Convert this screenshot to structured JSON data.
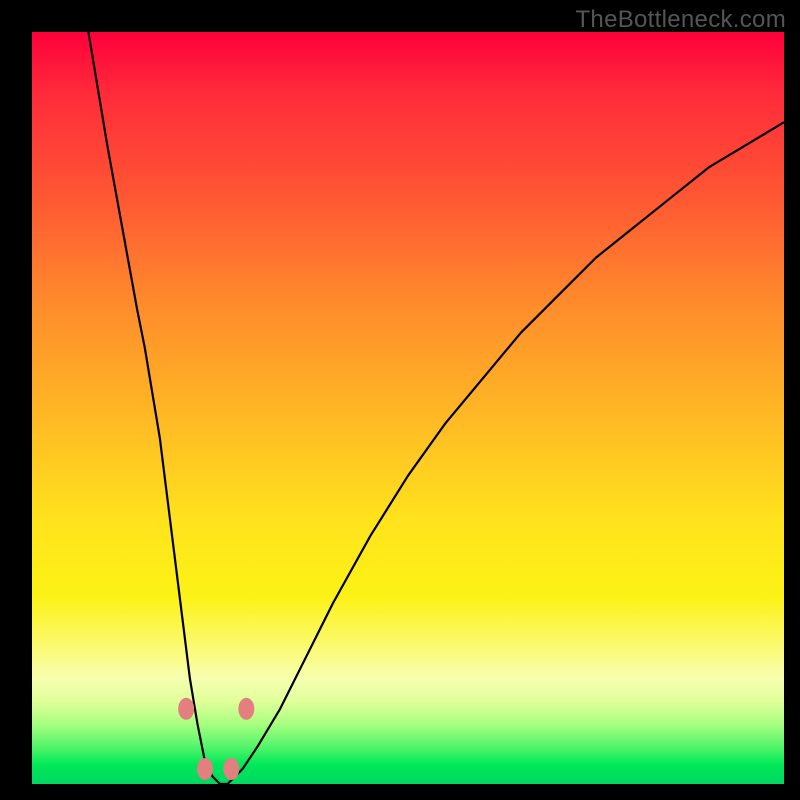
{
  "watermark": "TheBottleneck.com",
  "chart_data": {
    "type": "line",
    "title": "",
    "xlabel": "",
    "ylabel": "",
    "xlim": [
      0,
      100
    ],
    "ylim": [
      0,
      100
    ],
    "grid": false,
    "legend": false,
    "background": "rainbow-gradient-vertical",
    "series": [
      {
        "name": "curve",
        "x": [
          7.5,
          10,
          12,
          14,
          15,
          16,
          17,
          18,
          19,
          20,
          21,
          22,
          23,
          24,
          25,
          26,
          27,
          28,
          30,
          33,
          36,
          40,
          45,
          50,
          55,
          60,
          65,
          70,
          75,
          80,
          85,
          90,
          95,
          100
        ],
        "y": [
          100,
          85,
          74,
          63,
          58,
          52,
          46,
          38,
          30,
          22,
          14,
          8,
          3,
          1,
          0,
          0,
          1,
          2,
          5,
          10,
          16,
          24,
          33,
          41,
          48,
          54,
          60,
          65,
          70,
          74,
          78,
          82,
          85,
          88
        ]
      }
    ],
    "markers": [
      {
        "x": 20.5,
        "y": 10
      },
      {
        "x": 23,
        "y": 2
      },
      {
        "x": 26.5,
        "y": 2
      },
      {
        "x": 28.5,
        "y": 10
      }
    ],
    "colors": {
      "curve_stroke": "#000000",
      "marker_fill": "#e37f7f",
      "gradient_top": "#ff003a",
      "gradient_mid": "#ffe31d",
      "gradient_bottom": "#00d860",
      "frame": "#000000"
    }
  }
}
